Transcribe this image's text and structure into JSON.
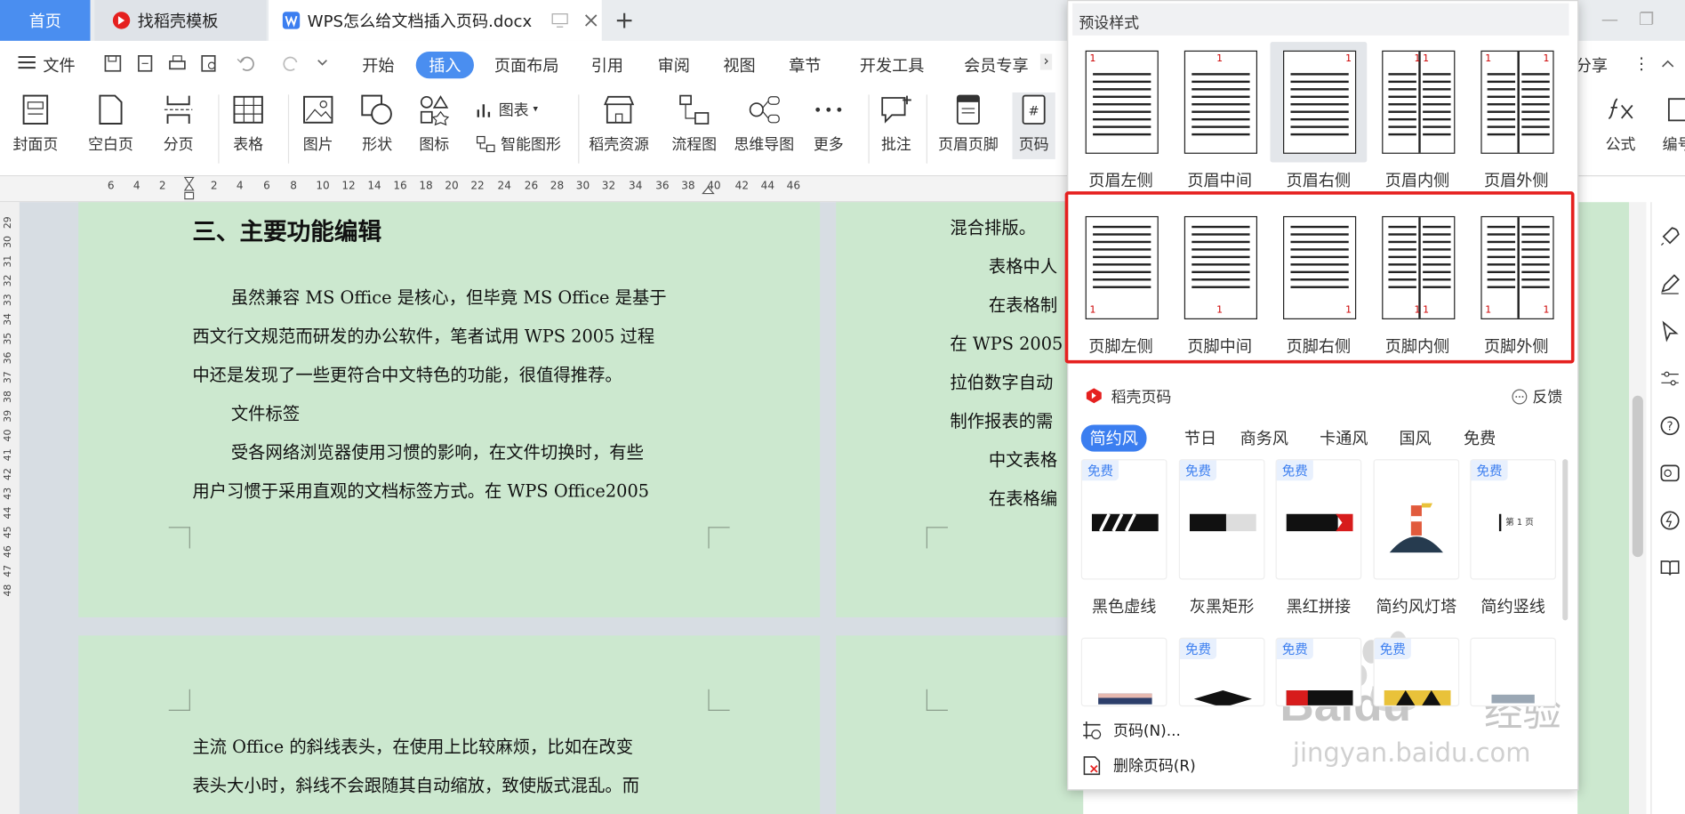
{
  "tabs": {
    "home": "首页",
    "templates": "找稻壳模板",
    "document": "WPS怎么给文档插入页码.docx"
  },
  "menu": {
    "file": "文件",
    "items": [
      "开始",
      "插入",
      "页面布局",
      "引用",
      "审阅",
      "视图",
      "章节",
      "开发工具",
      "会员专享"
    ],
    "share": "分享"
  },
  "ribbon": {
    "cover": "封面页",
    "blank": "空白页",
    "break": "分页",
    "table": "表格",
    "picture": "图片",
    "shape": "形状",
    "iconlib": "图标",
    "chart": "图表",
    "smartart": "智能图形",
    "docer": "稻壳资源",
    "flow": "流程图",
    "mindmap": "思维导图",
    "more": "更多",
    "comment": "批注",
    "headerfooter": "页眉页脚",
    "pagenum": "页码",
    "formula": "公式",
    "num": "编号"
  },
  "ruler": {
    "ticks": [
      "6",
      "4",
      "2",
      "2",
      "4",
      "6",
      "8",
      "10",
      "12",
      "14",
      "16",
      "18",
      "20",
      "22",
      "24",
      "26",
      "28",
      "30",
      "32",
      "34",
      "36",
      "38",
      "40",
      "42",
      "44",
      "46"
    ]
  },
  "vruler": {
    "ticks": [
      "29",
      "30",
      "31",
      "32",
      "33",
      "34",
      "35",
      "36",
      "37",
      "38",
      "39",
      "40",
      "41",
      "42",
      "43",
      "44",
      "45",
      "46",
      "47",
      "48"
    ]
  },
  "document": {
    "heading": "三、主要功能编辑",
    "p1_l1": "虽然兼容 MS Office 是核心，但毕竟 MS Office 是基于",
    "p1_l2": "西文行文规范而研发的办公软件，笔者试用 WPS 2005 过程",
    "p1_l3": "中还是发现了一些更符合中文特色的功能，很值得推荐。",
    "sub": "文件标签",
    "p2_l1": "受各网络浏览器使用习惯的影响，在文件切换时，有些",
    "p2_l2": "用户习惯于采用直观的文档标签方式。在 WPS Office2005",
    "right_lines": [
      "混合排版。",
      "表格中人",
      "在表格制",
      "在 WPS 2005",
      "拉伯数字自动",
      "制作报表的需",
      "中文表格",
      "在表格编"
    ],
    "p3_l1": "主流 Office 的斜线表头，在使用上比较麻烦，比如在改变",
    "p3_l2": "表头大小时，斜线不会跟随其自动缩放，致使版式混乱。而"
  },
  "popup": {
    "preset_title": "预设样式",
    "header_presets": [
      "页眉左侧",
      "页眉中间",
      "页眉右侧",
      "页眉内侧",
      "页眉外侧"
    ],
    "footer_presets": [
      "页脚左侧",
      "页脚中间",
      "页脚右侧",
      "页脚内侧",
      "页脚外侧"
    ],
    "num_label": "1",
    "docer_title": "稻壳页码",
    "feedback": "反馈",
    "categories": [
      "简约风",
      "节日",
      "商务风",
      "卡通风",
      "国风",
      "免费"
    ],
    "free_badge": "免费",
    "style_cards": [
      "黑色虚线",
      "灰黑矩形",
      "黑红拼接",
      "简约风灯塔",
      "简约竖线"
    ],
    "card_text": "第 1 页",
    "footer_items": [
      "页码(N)...",
      "删除页码(R)"
    ]
  },
  "watermark": {
    "brand": "Baidu",
    "cn": "经验",
    "url": "jingyan.baidu.com"
  },
  "colors": {
    "accent": "#4a8ef0",
    "page_bg": "#cce8cf",
    "highlight_box": "#e5201f"
  }
}
